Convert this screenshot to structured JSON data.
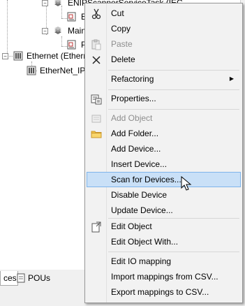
{
  "tree": {
    "items": [
      {
        "label": "ENIPScannerServiceTask (IEC",
        "icon": "task-icon"
      },
      {
        "label": "E",
        "icon": "program-icon"
      },
      {
        "label": "MainT",
        "icon": "task-icon"
      },
      {
        "label": "P",
        "icon": "program-icon"
      },
      {
        "label": "Ethernet (Etherne",
        "icon": "ethernet-device-icon"
      },
      {
        "label": "EtherNet_IP_",
        "icon": "ethernetip-device-icon"
      }
    ]
  },
  "bottom_tabs": [
    {
      "label": "ces"
    },
    {
      "label": "POUs",
      "icon": "pous-icon"
    }
  ],
  "context_menu": {
    "items": [
      {
        "label": "Cut",
        "icon": "scissors-icon",
        "enabled": true
      },
      {
        "label": "Copy",
        "icon": "",
        "enabled": true
      },
      {
        "label": "Paste",
        "icon": "paste-icon",
        "enabled": false
      },
      {
        "label": "Delete",
        "icon": "delete-x-icon",
        "enabled": true
      },
      {
        "label": "Refactoring",
        "submenu": true,
        "enabled": true
      },
      {
        "label": "Properties...",
        "icon": "properties-icon",
        "enabled": true
      },
      {
        "label": "Add Object",
        "icon": "add-object-icon",
        "enabled": false
      },
      {
        "label": "Add Folder...",
        "icon": "folder-icon",
        "enabled": true
      },
      {
        "label": "Add Device...",
        "enabled": true
      },
      {
        "label": "Insert Device...",
        "enabled": true
      },
      {
        "label": "Scan for Devices...",
        "enabled": true,
        "highlighted": true
      },
      {
        "label": "Disable Device",
        "enabled": true
      },
      {
        "label": "Update Device...",
        "enabled": true
      },
      {
        "label": "Edit Object",
        "icon": "edit-object-icon",
        "enabled": true
      },
      {
        "label": "Edit Object With...",
        "enabled": true
      },
      {
        "label": "Edit IO mapping",
        "enabled": true
      },
      {
        "label": "Import mappings from CSV...",
        "enabled": true
      },
      {
        "label": "Export mappings to CSV...",
        "enabled": true
      }
    ]
  },
  "colors": {
    "highlight_bg": "#c9e0f7",
    "highlight_border": "#7eb4ea",
    "disabled_text": "#8e8e8e",
    "menu_bg": "#f2f2f2"
  }
}
